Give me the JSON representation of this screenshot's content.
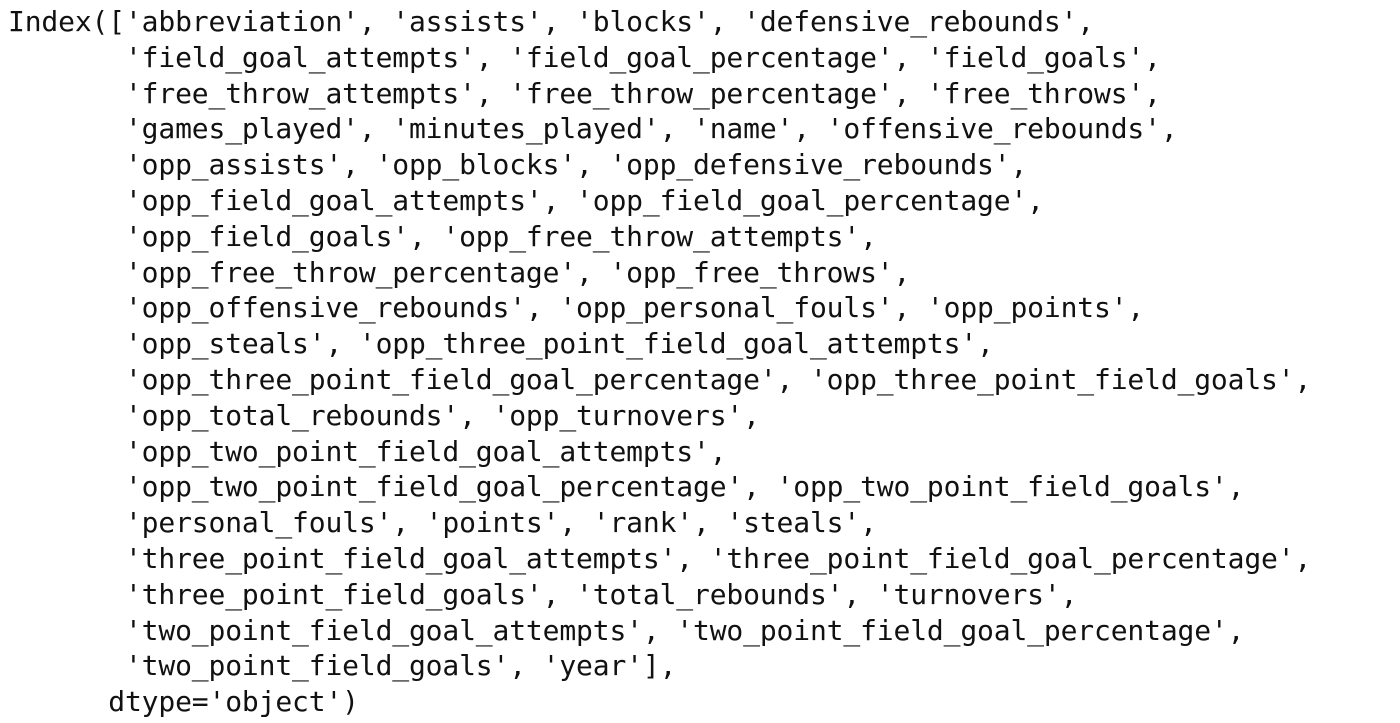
{
  "output": {
    "lines": [
      "Index(['abbreviation', 'assists', 'blocks', 'defensive_rebounds',",
      "       'field_goal_attempts', 'field_goal_percentage', 'field_goals',",
      "       'free_throw_attempts', 'free_throw_percentage', 'free_throws',",
      "       'games_played', 'minutes_played', 'name', 'offensive_rebounds',",
      "       'opp_assists', 'opp_blocks', 'opp_defensive_rebounds',",
      "       'opp_field_goal_attempts', 'opp_field_goal_percentage',",
      "       'opp_field_goals', 'opp_free_throw_attempts',",
      "       'opp_free_throw_percentage', 'opp_free_throws',",
      "       'opp_offensive_rebounds', 'opp_personal_fouls', 'opp_points',",
      "       'opp_steals', 'opp_three_point_field_goal_attempts',",
      "       'opp_three_point_field_goal_percentage', 'opp_three_point_field_goals',",
      "       'opp_total_rebounds', 'opp_turnovers',",
      "       'opp_two_point_field_goal_attempts',",
      "       'opp_two_point_field_goal_percentage', 'opp_two_point_field_goals',",
      "       'personal_fouls', 'points', 'rank', 'steals',",
      "       'three_point_field_goal_attempts', 'three_point_field_goal_percentage',",
      "       'three_point_field_goals', 'total_rebounds', 'turnovers',",
      "       'two_point_field_goal_attempts', 'two_point_field_goal_percentage',",
      "       'two_point_field_goals', 'year'],",
      "      dtype='object')"
    ]
  }
}
